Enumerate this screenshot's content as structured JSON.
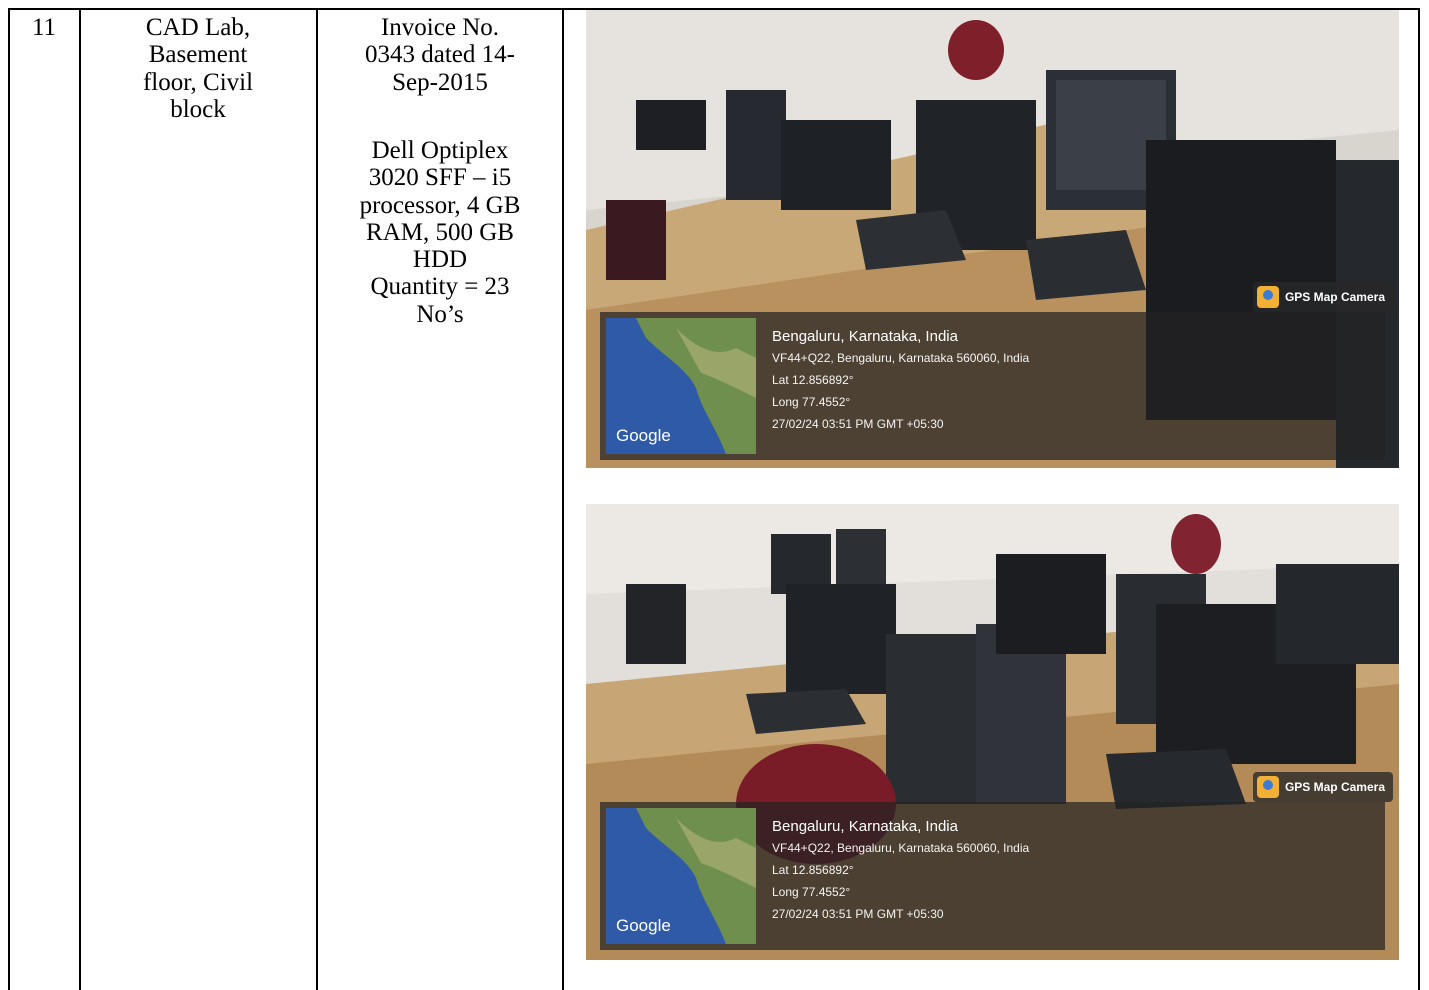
{
  "row": {
    "number": "11",
    "location": "CAD Lab,\nBasement\nfloor, Civil\nblock",
    "invoice": "Invoice No.\n0343 dated 14-\nSep-2015",
    "description": "Dell Optiplex\n3020 SFF – i5\nprocessor, 4 GB\nRAM, 500 GB\nHDD\nQuantity = 23\nNo’s"
  },
  "photos": [
    {
      "badge": "GPS Map Camera",
      "map_label": "Google",
      "place": "Bengaluru, Karnataka, India",
      "address": "VF44+Q22, Bengaluru, Karnataka 560060, India",
      "lat": "Lat 12.856892°",
      "long": "Long 77.4552°",
      "timestamp": "27/02/24 03:51 PM GMT +05:30"
    },
    {
      "badge": "GPS Map Camera",
      "map_label": "Google",
      "place": "Bengaluru, Karnataka, India",
      "address": "VF44+Q22, Bengaluru, Karnataka 560060, India",
      "lat": "Lat 12.856892°",
      "long": "Long 77.4552°",
      "timestamp": "27/02/24 03:51 PM GMT +05:30"
    }
  ]
}
